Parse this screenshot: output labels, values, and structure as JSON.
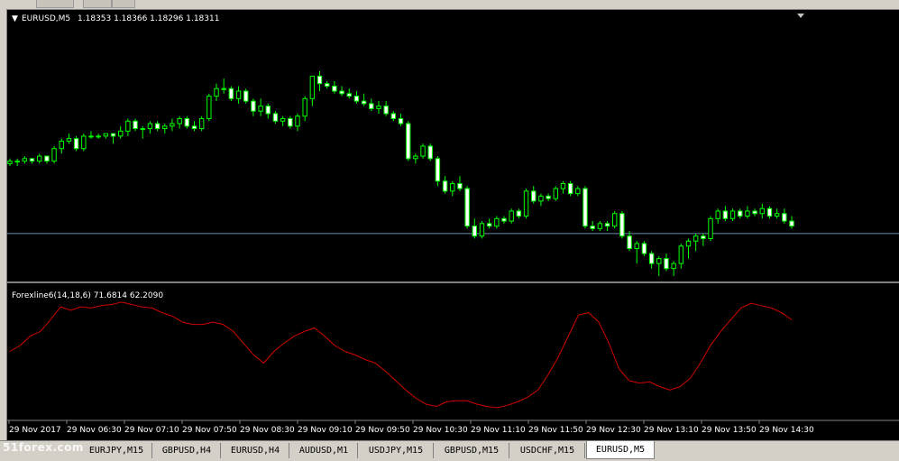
{
  "main_chart": {
    "title": "EURUSD,M5",
    "ohlc_text": "1.18353 1.18366 1.18296 1.18311"
  },
  "indicator": {
    "title": "Forexline6(14,18,6) 71.6814 62.2090"
  },
  "time_axis": [
    "29 Nov 2017",
    "29 Nov 06:30",
    "29 Nov 07:10",
    "29 Nov 07:50",
    "29 Nov 08:30",
    "29 Nov 09:10",
    "29 Nov 09:50",
    "29 Nov 10:30",
    "29 Nov 11:10",
    "29 Nov 11:50",
    "29 Nov 12:30",
    "29 Nov 13:10",
    "29 Nov 13:50",
    "29 Nov 14:30"
  ],
  "tabs": [
    {
      "label": "EURJPY,M15",
      "active": false
    },
    {
      "label": "GBPUSD,H4",
      "active": false
    },
    {
      "label": "EURUSD,H4",
      "active": false
    },
    {
      "label": "AUDUSD,M1",
      "active": false
    },
    {
      "label": "USDJPY,M15",
      "active": false
    },
    {
      "label": "GBPUSD,M15",
      "active": false
    },
    {
      "label": "USDCHF,M15",
      "active": false
    },
    {
      "label": "EURUSD,M5",
      "active": true
    }
  ],
  "watermark": "51forex.com",
  "colors": {
    "background": "#000000",
    "candle": "#00ff00",
    "candle_body_bull": "#000000",
    "candle_body_bear": "#ffffff",
    "price_line": "#6a8ca8",
    "indicator_line": "#d00000",
    "text": "#ffffff",
    "separator": "#808080"
  },
  "chart_data": [
    {
      "type": "candlestick",
      "title": "EURUSD,M5",
      "x": "5-minute bars, 29 Nov 2017",
      "current_price_line": 0.17,
      "ylim": [
        0,
        1
      ],
      "candles": [
        [
          0.45,
          0.47,
          0.44,
          0.46
        ],
        [
          0.46,
          0.47,
          0.44,
          0.46
        ],
        [
          0.46,
          0.48,
          0.45,
          0.47
        ],
        [
          0.47,
          0.47,
          0.45,
          0.46
        ],
        [
          0.46,
          0.49,
          0.45,
          0.48
        ],
        [
          0.48,
          0.48,
          0.45,
          0.46
        ],
        [
          0.46,
          0.52,
          0.45,
          0.51
        ],
        [
          0.51,
          0.55,
          0.49,
          0.54
        ],
        [
          0.54,
          0.57,
          0.53,
          0.55
        ],
        [
          0.55,
          0.56,
          0.5,
          0.51
        ],
        [
          0.51,
          0.57,
          0.5,
          0.56
        ],
        [
          0.56,
          0.58,
          0.55,
          0.56
        ],
        [
          0.56,
          0.57,
          0.55,
          0.56
        ],
        [
          0.56,
          0.57,
          0.55,
          0.57
        ],
        [
          0.57,
          0.57,
          0.53,
          0.56
        ],
        [
          0.56,
          0.6,
          0.55,
          0.58
        ],
        [
          0.58,
          0.63,
          0.56,
          0.62
        ],
        [
          0.62,
          0.63,
          0.58,
          0.59
        ],
        [
          0.59,
          0.6,
          0.55,
          0.59
        ],
        [
          0.59,
          0.62,
          0.57,
          0.61
        ],
        [
          0.61,
          0.62,
          0.58,
          0.59
        ],
        [
          0.59,
          0.61,
          0.57,
          0.6
        ],
        [
          0.6,
          0.63,
          0.58,
          0.61
        ],
        [
          0.61,
          0.64,
          0.59,
          0.63
        ],
        [
          0.63,
          0.64,
          0.59,
          0.6
        ],
        [
          0.6,
          0.62,
          0.58,
          0.59
        ],
        [
          0.59,
          0.64,
          0.58,
          0.63
        ],
        [
          0.63,
          0.73,
          0.62,
          0.72
        ],
        [
          0.72,
          0.77,
          0.7,
          0.75
        ],
        [
          0.75,
          0.79,
          0.73,
          0.75
        ],
        [
          0.75,
          0.76,
          0.7,
          0.71
        ],
        [
          0.71,
          0.76,
          0.69,
          0.74
        ],
        [
          0.74,
          0.75,
          0.69,
          0.7
        ],
        [
          0.7,
          0.71,
          0.64,
          0.66
        ],
        [
          0.66,
          0.71,
          0.64,
          0.68
        ],
        [
          0.68,
          0.69,
          0.63,
          0.65
        ],
        [
          0.65,
          0.66,
          0.61,
          0.62
        ],
        [
          0.62,
          0.64,
          0.6,
          0.63
        ],
        [
          0.63,
          0.64,
          0.59,
          0.6
        ],
        [
          0.6,
          0.65,
          0.58,
          0.64
        ],
        [
          0.64,
          0.72,
          0.62,
          0.71
        ],
        [
          0.71,
          0.8,
          0.68,
          0.8
        ],
        [
          0.8,
          0.82,
          0.74,
          0.77
        ],
        [
          0.77,
          0.78,
          0.75,
          0.76
        ],
        [
          0.76,
          0.78,
          0.73,
          0.74
        ],
        [
          0.74,
          0.76,
          0.72,
          0.73
        ],
        [
          0.73,
          0.75,
          0.71,
          0.72
        ],
        [
          0.72,
          0.74,
          0.69,
          0.7
        ],
        [
          0.7,
          0.73,
          0.68,
          0.69
        ],
        [
          0.69,
          0.71,
          0.66,
          0.67
        ],
        [
          0.67,
          0.7,
          0.65,
          0.68
        ],
        [
          0.68,
          0.7,
          0.64,
          0.65
        ],
        [
          0.65,
          0.66,
          0.62,
          0.63
        ],
        [
          0.63,
          0.65,
          0.6,
          0.61
        ],
        [
          0.61,
          0.62,
          0.46,
          0.47
        ],
        [
          0.47,
          0.49,
          0.45,
          0.48
        ],
        [
          0.48,
          0.53,
          0.47,
          0.52
        ],
        [
          0.52,
          0.53,
          0.46,
          0.47
        ],
        [
          0.47,
          0.48,
          0.36,
          0.38
        ],
        [
          0.38,
          0.4,
          0.33,
          0.34
        ],
        [
          0.34,
          0.38,
          0.32,
          0.37
        ],
        [
          0.37,
          0.4,
          0.34,
          0.35
        ],
        [
          0.35,
          0.36,
          0.19,
          0.2
        ],
        [
          0.2,
          0.23,
          0.15,
          0.16
        ],
        [
          0.16,
          0.22,
          0.15,
          0.21
        ],
        [
          0.21,
          0.23,
          0.19,
          0.2
        ],
        [
          0.2,
          0.24,
          0.19,
          0.23
        ],
        [
          0.23,
          0.24,
          0.21,
          0.22
        ],
        [
          0.22,
          0.27,
          0.21,
          0.26
        ],
        [
          0.26,
          0.27,
          0.23,
          0.24
        ],
        [
          0.24,
          0.35,
          0.23,
          0.34
        ],
        [
          0.34,
          0.36,
          0.29,
          0.3
        ],
        [
          0.3,
          0.33,
          0.28,
          0.32
        ],
        [
          0.32,
          0.33,
          0.3,
          0.31
        ],
        [
          0.31,
          0.36,
          0.3,
          0.35
        ],
        [
          0.35,
          0.38,
          0.33,
          0.37
        ],
        [
          0.37,
          0.38,
          0.32,
          0.33
        ],
        [
          0.33,
          0.36,
          0.32,
          0.35
        ],
        [
          0.35,
          0.36,
          0.19,
          0.2
        ],
        [
          0.2,
          0.22,
          0.18,
          0.19
        ],
        [
          0.19,
          0.22,
          0.18,
          0.21
        ],
        [
          0.21,
          0.22,
          0.18,
          0.2
        ],
        [
          0.2,
          0.26,
          0.19,
          0.25
        ],
        [
          0.25,
          0.26,
          0.15,
          0.16
        ],
        [
          0.16,
          0.18,
          0.1,
          0.11
        ],
        [
          0.11,
          0.14,
          0.05,
          0.13
        ],
        [
          0.13,
          0.14,
          0.08,
          0.09
        ],
        [
          0.09,
          0.1,
          0.03,
          0.05
        ],
        [
          0.05,
          0.08,
          0.0,
          0.07
        ],
        [
          0.07,
          0.09,
          0.02,
          0.03
        ],
        [
          0.03,
          0.06,
          0.0,
          0.05
        ],
        [
          0.05,
          0.13,
          0.03,
          0.12
        ],
        [
          0.12,
          0.15,
          0.07,
          0.14
        ],
        [
          0.14,
          0.17,
          0.1,
          0.16
        ],
        [
          0.16,
          0.17,
          0.12,
          0.15
        ],
        [
          0.15,
          0.24,
          0.14,
          0.23
        ],
        [
          0.23,
          0.27,
          0.21,
          0.26
        ],
        [
          0.26,
          0.28,
          0.22,
          0.23
        ],
        [
          0.23,
          0.27,
          0.22,
          0.26
        ],
        [
          0.26,
          0.27,
          0.23,
          0.24
        ],
        [
          0.24,
          0.28,
          0.23,
          0.26
        ],
        [
          0.26,
          0.27,
          0.24,
          0.25
        ],
        [
          0.25,
          0.29,
          0.23,
          0.27
        ],
        [
          0.27,
          0.28,
          0.23,
          0.24
        ],
        [
          0.24,
          0.27,
          0.23,
          0.25
        ],
        [
          0.25,
          0.27,
          0.21,
          0.22
        ],
        [
          0.22,
          0.24,
          0.19,
          0.2
        ]
      ]
    },
    {
      "type": "line",
      "title": "Forexline6(14,18,6) 71.6814 62.2090",
      "series": [
        {
          "values": [
            0.55,
            0.6,
            0.68,
            0.72,
            0.82,
            0.93,
            0.9,
            0.93,
            0.92,
            0.94,
            0.95,
            0.97,
            0.95,
            0.93,
            0.92,
            0.88,
            0.85,
            0.8,
            0.78,
            0.78,
            0.8,
            0.78,
            0.72,
            0.62,
            0.52,
            0.45,
            0.55,
            0.62,
            0.68,
            0.72,
            0.75,
            0.68,
            0.6,
            0.55,
            0.52,
            0.48,
            0.45,
            0.38,
            0.3,
            0.22,
            0.15,
            0.1,
            0.08,
            0.12,
            0.13,
            0.13,
            0.1,
            0.08,
            0.07,
            0.09,
            0.12,
            0.16,
            0.22,
            0.35,
            0.5,
            0.68,
            0.86,
            0.88,
            0.8,
            0.62,
            0.4,
            0.3,
            0.28,
            0.29,
            0.25,
            0.22,
            0.25,
            0.32,
            0.45,
            0.6,
            0.72,
            0.82,
            0.92,
            0.96,
            0.94,
            0.92,
            0.88,
            0.82
          ]
        }
      ],
      "ylim": [
        0,
        1
      ]
    }
  ]
}
